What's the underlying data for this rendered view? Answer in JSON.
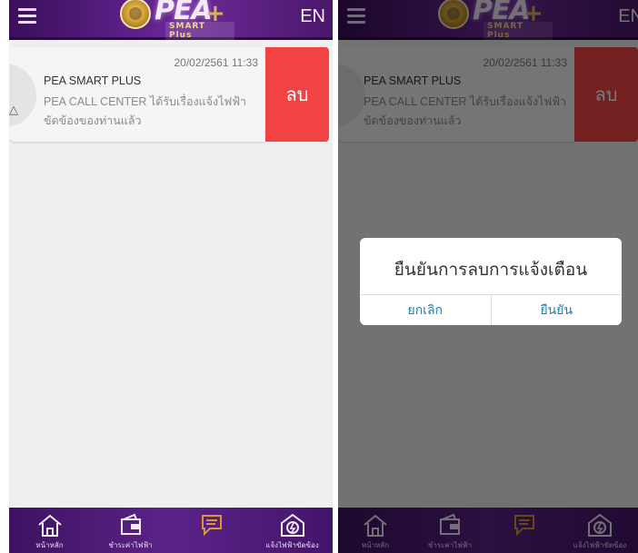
{
  "header": {
    "lang": "EN",
    "logo_text": "PEA",
    "logo_sub": "SMART Plus"
  },
  "notification": {
    "time": "20/02/2561 11:33",
    "title": "PEA SMART PLUS",
    "body": "PEA CALL CENTER ได้รับเรื่องแจ้งไฟฟ้าขัดข้องของท่านแล้ว",
    "delete_label": "ลบ"
  },
  "nav": [
    {
      "label": "หน้าหลัก",
      "icon": "home-icon"
    },
    {
      "label": "ชำระค่าไฟฟ้า",
      "icon": "wallet-icon"
    },
    {
      "label": "",
      "icon": "chat-icon",
      "active": true
    },
    {
      "label": "แจ้งไฟฟ้าขัดข้อง",
      "icon": "power-alert-icon"
    }
  ],
  "dialog": {
    "message": "ยืนยันการลบการแจ้งเตือน",
    "cancel_label": "ยกเลิก",
    "confirm_label": "ยืนยัน"
  },
  "colors": {
    "accent": "#5a1f86",
    "delete": "#f14343",
    "dialog_link": "#1f7fa8",
    "nav_active": "#d89a2e"
  }
}
